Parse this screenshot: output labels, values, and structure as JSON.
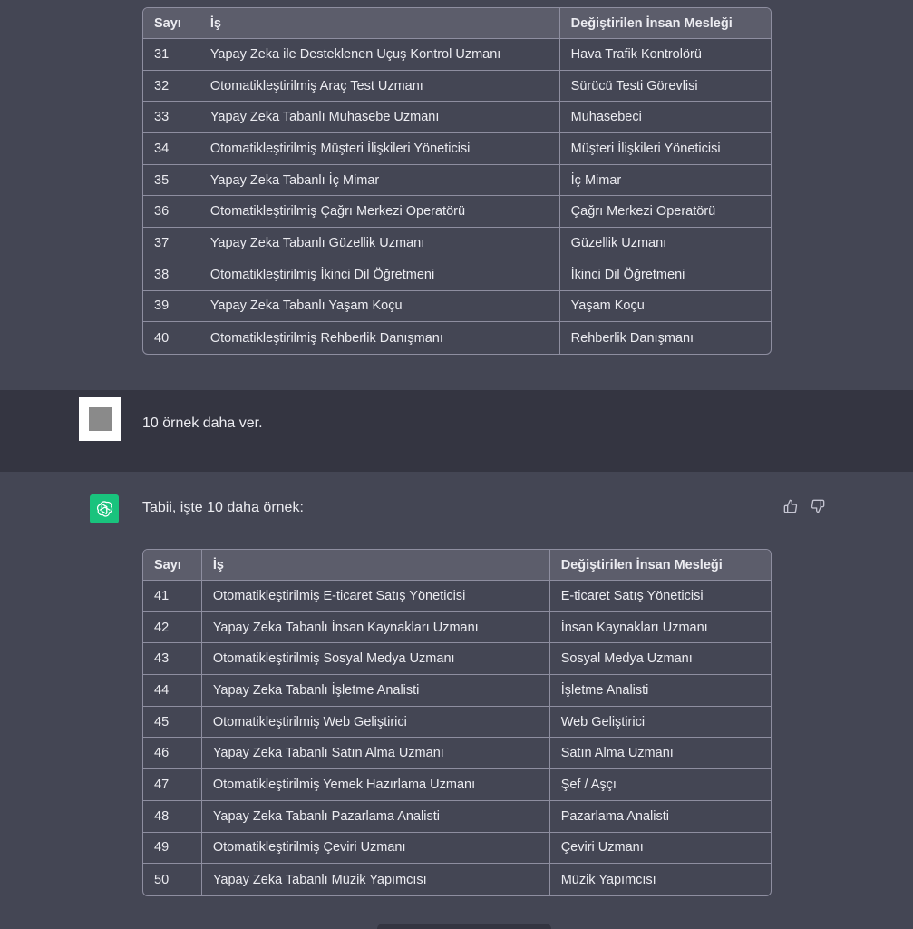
{
  "table1": {
    "headers": [
      "Sayı",
      "İş",
      "Değiştirilen İnsan Mesleği"
    ],
    "rows": [
      [
        "31",
        "Yapay Zeka ile Desteklenen Uçuş Kontrol Uzmanı",
        "Hava Trafik Kontrolörü"
      ],
      [
        "32",
        "Otomatikleştirilmiş Araç Test Uzmanı",
        "Sürücü Testi Görevlisi"
      ],
      [
        "33",
        "Yapay Zeka Tabanlı Muhasebe Uzmanı",
        "Muhasebeci"
      ],
      [
        "34",
        "Otomatikleştirilmiş Müşteri İlişkileri Yöneticisi",
        "Müşteri İlişkileri Yöneticisi"
      ],
      [
        "35",
        "Yapay Zeka Tabanlı İç Mimar",
        "İç Mimar"
      ],
      [
        "36",
        "Otomatikleştirilmiş Çağrı Merkezi Operatörü",
        "Çağrı Merkezi Operatörü"
      ],
      [
        "37",
        "Yapay Zeka Tabanlı Güzellik Uzmanı",
        "Güzellik Uzmanı"
      ],
      [
        "38",
        "Otomatikleştirilmiş İkinci Dil Öğretmeni",
        "İkinci Dil Öğretmeni"
      ],
      [
        "39",
        "Yapay Zeka Tabanlı Yaşam Koçu",
        "Yaşam Koçu"
      ],
      [
        "40",
        "Otomatikleştirilmiş Rehberlik Danışmanı",
        "Rehberlik Danışmanı"
      ]
    ]
  },
  "user_message": {
    "text": "10 örnek daha ver."
  },
  "assistant_message": {
    "intro": "Tabii, işte 10 daha örnek:"
  },
  "table2": {
    "headers": [
      "Sayı",
      "İş",
      "Değiştirilen İnsan Mesleği"
    ],
    "rows": [
      [
        "41",
        "Otomatikleştirilmiş E-ticaret Satış Yöneticisi",
        "E-ticaret Satış Yöneticisi"
      ],
      [
        "42",
        "Yapay Zeka Tabanlı İnsan Kaynakları Uzmanı",
        "İnsan Kaynakları Uzmanı"
      ],
      [
        "43",
        "Otomatikleştirilmiş Sosyal Medya Uzmanı",
        "Sosyal Medya Uzmanı"
      ],
      [
        "44",
        "Yapay Zeka Tabanlı İşletme Analisti",
        "İşletme Analisti"
      ],
      [
        "45",
        "Otomatikleştirilmiş Web Geliştirici",
        "Web Geliştirici"
      ],
      [
        "46",
        "Yapay Zeka Tabanlı Satın Alma Uzmanı",
        "Satın Alma Uzmanı"
      ],
      [
        "47",
        "Otomatikleştirilmiş Yemek Hazırlama Uzmanı",
        "Şef / Aşçı"
      ],
      [
        "48",
        "Yapay Zeka Tabanlı Pazarlama Analisti",
        "Pazarlama Analisti"
      ],
      [
        "49",
        "Otomatikleştirilmiş Çeviri Uzmanı",
        "Çeviri Uzmanı"
      ],
      [
        "50",
        "Yapay Zeka Tabanlı Müzik Yapımcısı",
        "Müzik Yapımcısı"
      ]
    ]
  },
  "icons": {
    "assistant_avatar": "openai-logo-icon",
    "user_avatar": "user-avatar-icon",
    "thumb_up": "thumbs-up-icon",
    "thumb_down": "thumbs-down-icon"
  },
  "colors": {
    "assistant_bg": "#444654",
    "user_bg": "#343541",
    "bot_avatar": "#19c37d",
    "table_header_bg": "#5c5d6b"
  }
}
